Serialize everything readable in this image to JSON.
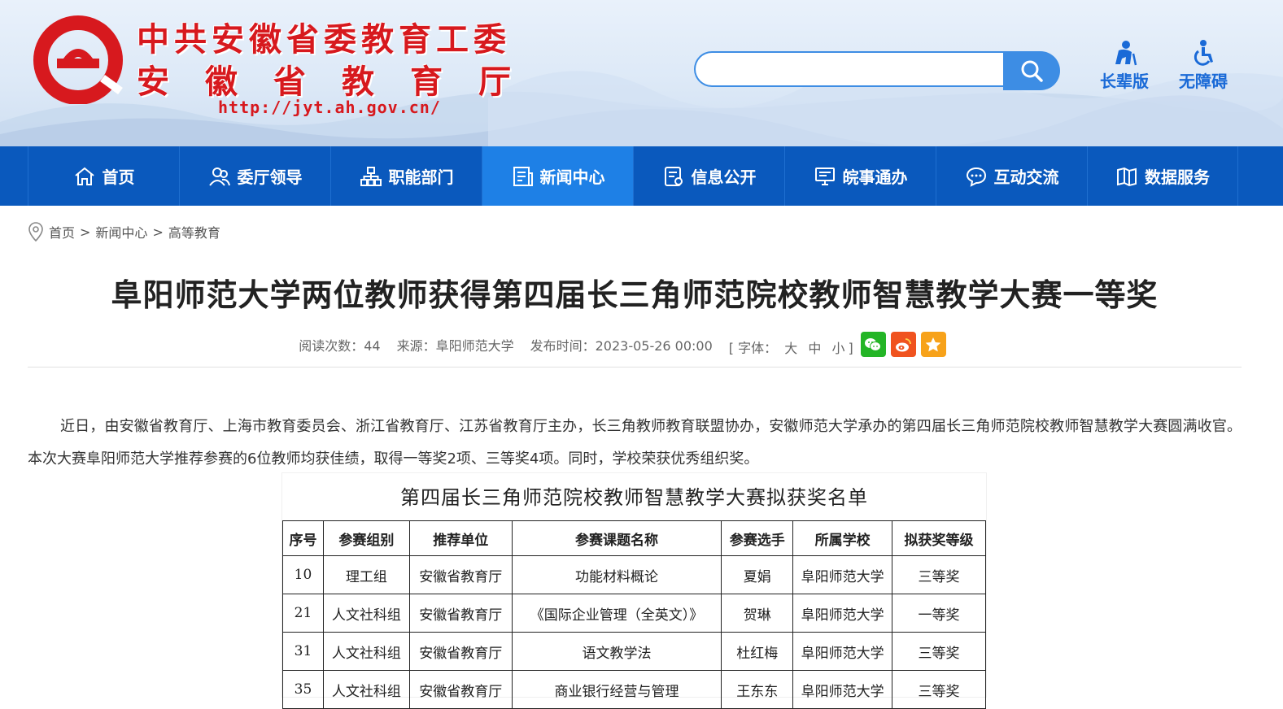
{
  "header": {
    "site_name_line1": "中共安徽省委教育工委",
    "site_name_line2": "安徽省教育厅",
    "site_url": "http://jyt.ah.gov.cn/",
    "search_placeholder": "",
    "tools": [
      {
        "label": "长辈版",
        "icon": "elder-icon"
      },
      {
        "label": "无障碍",
        "icon": "accessibility-icon"
      }
    ]
  },
  "nav": {
    "items": [
      {
        "label": "首页",
        "icon": "home-icon"
      },
      {
        "label": "委厅领导",
        "icon": "leaders-icon"
      },
      {
        "label": "职能部门",
        "icon": "org-icon"
      },
      {
        "label": "新闻中心",
        "icon": "news-icon",
        "active": true
      },
      {
        "label": "信息公开",
        "icon": "info-icon"
      },
      {
        "label": "皖事通办",
        "icon": "service-icon"
      },
      {
        "label": "互动交流",
        "icon": "chat-icon"
      },
      {
        "label": "数据服务",
        "icon": "data-icon"
      }
    ]
  },
  "breadcrumb": {
    "items": [
      "首页",
      "新闻中心",
      "高等教育"
    ],
    "separator": ">"
  },
  "article": {
    "title": "阜阳师范大学两位教师获得第四届长三角师范院校教师智慧教学大赛一等奖",
    "read_label": "阅读次数：",
    "read_count": "44",
    "source_label": "来源：",
    "source": "阜阳师范大学",
    "time_label": "发布时间：",
    "time": "2023-05-26 00:00",
    "font_label": "[ 字体：",
    "font_large": "大",
    "font_medium": "中",
    "font_small": "小",
    "font_close": "]",
    "paragraph": "近日，由安徽省教育厅、上海市教育委员会、浙江省教育厅、江苏省教育厅主办，长三角教师教育联盟协办，安徽师范大学承办的第四届长三角师范院校教师智慧教学大赛圆满收官。本次大赛阜阳师范大学推荐参赛的6位教师均获佳绩，取得一等奖2项、三等奖4项。同时，学校荣获优秀组织奖。"
  },
  "award_image": {
    "title": "第四届长三角师范院校教师智慧教学大赛拟获奖名单",
    "headers": [
      "序号",
      "参赛组别",
      "推荐单位",
      "参赛课题名称",
      "参赛选手",
      "所属学校",
      "拟获奖等级"
    ],
    "rows": [
      [
        "10",
        "理工组",
        "安徽省教育厅",
        "功能材料概论",
        "夏娟",
        "阜阳师范大学",
        "三等奖"
      ],
      [
        "21",
        "人文社科组",
        "安徽省教育厅",
        "《国际企业管理（全英文）》",
        "贺琳",
        "阜阳师范大学",
        "一等奖"
      ],
      [
        "31",
        "人文社科组",
        "安徽省教育厅",
        "语文教学法",
        "杜红梅",
        "阜阳师范大学",
        "三等奖"
      ],
      [
        "35",
        "人文社科组",
        "安徽省教育厅",
        "商业银行经营与管理",
        "王东东",
        "阜阳师范大学",
        "三等奖"
      ]
    ]
  },
  "colors": {
    "brand_red": "#d7191e",
    "nav_blue": "#0a59bd",
    "nav_active": "#1e80e6",
    "search_blue": "#3d8de4",
    "link_blue": "#1a6ad7"
  }
}
